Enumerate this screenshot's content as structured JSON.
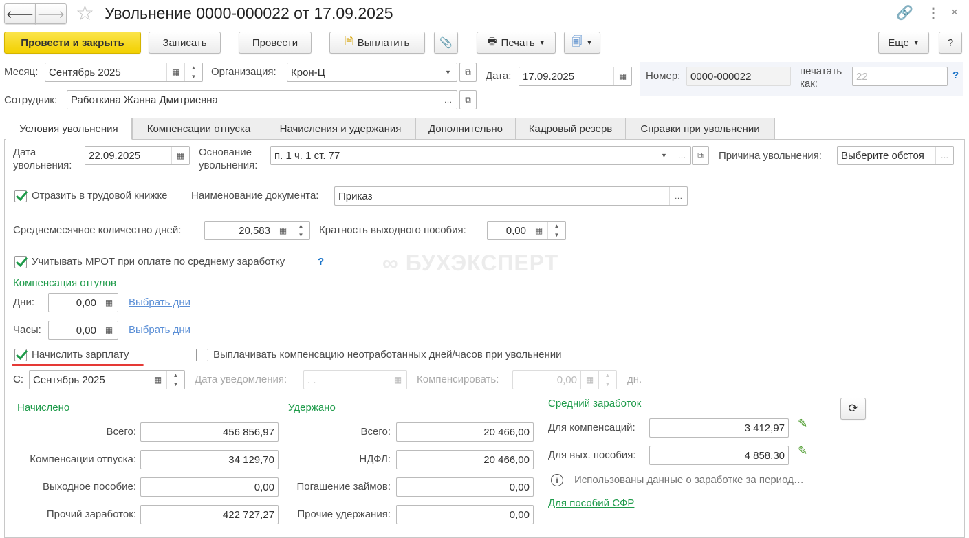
{
  "window": {
    "title": "Увольнение 0000-000022 от 17.09.2025"
  },
  "toolbar": {
    "post_close": "Провести и закрыть",
    "save": "Записать",
    "post": "Провести",
    "pay": "Выплатить",
    "print": "Печать",
    "more": "Еще",
    "help": "?"
  },
  "header": {
    "month_label": "Месяц:",
    "month_value": "Сентябрь 2025",
    "org_label": "Организация:",
    "org_value": "Крон-Ц",
    "date_label": "Дата:",
    "date_value": "17.09.2025",
    "number_label": "Номер:",
    "number_value": "0000-000022",
    "print_as_label1": "печатать",
    "print_as_label2": "как:",
    "print_as_value": "22",
    "print_as_help": "?",
    "employee_label": "Сотрудник:",
    "employee_value": "Работкина Жанна Дмитриевна"
  },
  "tabs": [
    "Условия увольнения",
    "Компенсации отпуска",
    "Начисления и удержания",
    "Дополнительно",
    "Кадровый резерв",
    "Справки при увольнении"
  ],
  "form": {
    "dismissal_date_label1": "Дата",
    "dismissal_date_label2": "увольнения:",
    "dismissal_date": "22.09.2025",
    "basis_label1": "Основание",
    "basis_label2": "увольнения:",
    "basis_value": "п. 1 ч. 1 ст. 77",
    "reason_label": "Причина увольнения:",
    "reason_value": "Выберите обстоя",
    "workbook_check": "Отразить в трудовой книжке",
    "doc_name_label": "Наименование документа:",
    "doc_name_value": "Приказ",
    "avg_days_label": "Среднемесячное количество дней:",
    "avg_days_value": "20,583",
    "severance_mult_label": "Кратность выходного пособия:",
    "severance_mult_value": "0,00",
    "mrot_check": "Учитывать МРОТ при оплате по среднему заработку",
    "mrot_help": "?",
    "timeoff_title": "Компенсация отгулов",
    "days_label": "Дни:",
    "days_value": "0,00",
    "hours_label": "Часы:",
    "hours_value": "0,00",
    "choose_days": "Выбрать дни",
    "accrue_salary_check": "Начислить зарплату",
    "pay_comp_check": "Выплачивать компенсацию неотработанных дней/часов при увольнении",
    "from_label": "С:",
    "from_value": "Сентябрь 2025",
    "notice_date_label": "Дата уведомления:",
    "notice_date_value": " .  .",
    "compensate_label": "Компенсировать:",
    "compensate_value": "0,00",
    "compensate_unit": "дн.",
    "watermark": "БУХЭКСПЕРТ"
  },
  "accrued": {
    "title": "Начислено",
    "rows": [
      {
        "label": "Всего:",
        "value": "456 856,97"
      },
      {
        "label": "Компенсации отпуска:",
        "value": "34 129,70"
      },
      {
        "label": "Выходное пособие:",
        "value": "0,00"
      },
      {
        "label": "Прочий заработок:",
        "value": "422 727,27"
      }
    ]
  },
  "withheld": {
    "title": "Удержано",
    "rows": [
      {
        "label": "Всего:",
        "value": "20 466,00"
      },
      {
        "label": "НДФЛ:",
        "value": "20 466,00"
      },
      {
        "label": "Погашение займов:",
        "value": "0,00"
      },
      {
        "label": "Прочие удержания:",
        "value": "0,00"
      }
    ]
  },
  "avg_earnings": {
    "title": "Средний заработок",
    "comp_label": "Для компенсаций:",
    "comp_value": "3 412,97",
    "sev_label": "Для вых. пособия:",
    "sev_value": "4 858,30",
    "info": "Использованы данные о заработке за период…",
    "sfr_link": "Для пособий СФР"
  },
  "colors": {
    "accent_yellow": "#f2d000",
    "green": "#1e9b4a",
    "link": "#5b8fd6",
    "underline_red": "#e53935"
  }
}
